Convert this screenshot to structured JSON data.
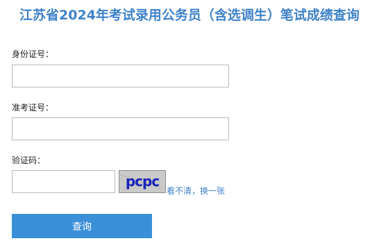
{
  "header": {
    "title": "江苏省2024年考试录用公务员（含选调生）笔试成绩查询"
  },
  "form": {
    "id_label": "身份证号：",
    "id_value": "",
    "exam_label": "准考证号：",
    "exam_value": "",
    "captcha_label": "验证码：",
    "captcha_value": "",
    "captcha_text": "pcpc",
    "refresh_text": "看不清，换一张",
    "submit_label": "查询"
  },
  "colors": {
    "accent": "#3f82c9",
    "button": "#3b8fd9",
    "captcha_text": "#1a23b8",
    "captcha_bg": "#c9c9c9"
  }
}
